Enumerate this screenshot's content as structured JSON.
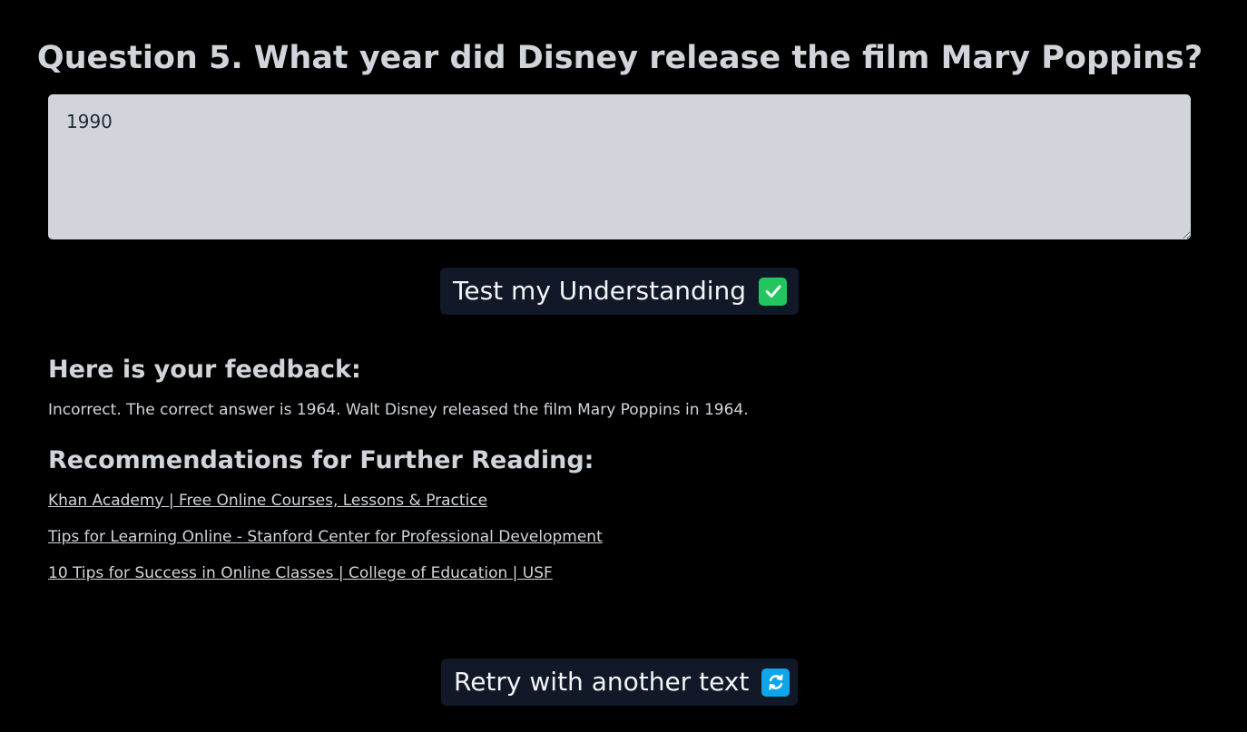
{
  "question": {
    "title": "Question 5. What year did Disney release the film Mary Poppins?"
  },
  "answer": {
    "value": "1990"
  },
  "test_button": {
    "label": "Test my Understanding"
  },
  "feedback": {
    "heading": "Here is your feedback:",
    "text": "Incorrect. The correct answer is 1964. Walt Disney released the film Mary Poppins in 1964."
  },
  "recommendations": {
    "heading": "Recommendations for Further Reading:",
    "links": [
      {
        "label": "Khan Academy | Free Online Courses, Lessons & Practice"
      },
      {
        "label": "Tips for Learning Online - Stanford Center for Professional Development"
      },
      {
        "label": "10 Tips for Success in Online Classes | College of Education | USF"
      }
    ]
  },
  "retry_button": {
    "label": "Retry with another text"
  },
  "icons": {
    "test": "check-mark-button-icon",
    "retry": "repeat-arrows-icon"
  },
  "colors": {
    "background": "#000000",
    "text": "#d1d5db",
    "button_bg": "#111827",
    "check_green": "#22c55e",
    "retry_blue": "#0ea5e9",
    "textarea_bg": "#d1d5db"
  }
}
